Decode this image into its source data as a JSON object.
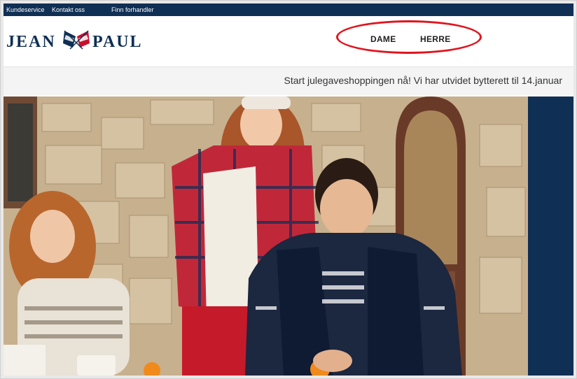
{
  "topbar": {
    "links": [
      "Kundeservice",
      "Kontakt oss",
      "Finn forhandler"
    ]
  },
  "brand": {
    "left": "JEAN",
    "right": "PAUL",
    "logo_icon": "crossed-flags-icon",
    "navy": "#0f2f54"
  },
  "nav": {
    "items": [
      "DAME",
      "HERRE"
    ],
    "highlight_color": "#e0141d"
  },
  "promo": {
    "text": "Start julegaveshoppingen nå! Vi har utvidet bytterett til 14.januar"
  },
  "hero": {
    "image_icon": "hero-photo-family-outdoors-icon"
  }
}
